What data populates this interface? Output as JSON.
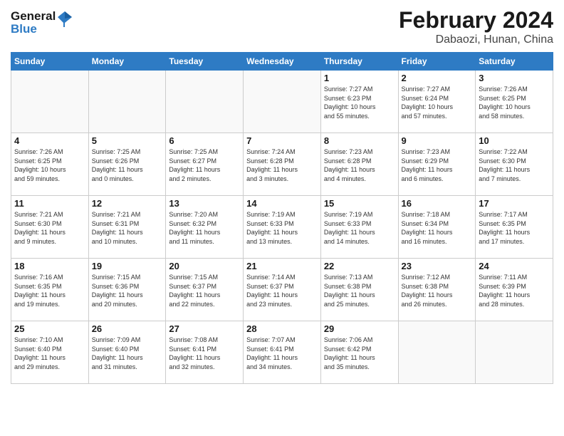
{
  "header": {
    "logo_line1": "General",
    "logo_line2": "Blue",
    "title": "February 2024",
    "subtitle": "Dabaozi, Hunan, China"
  },
  "weekdays": [
    "Sunday",
    "Monday",
    "Tuesday",
    "Wednesday",
    "Thursday",
    "Friday",
    "Saturday"
  ],
  "weeks": [
    [
      {
        "day": "",
        "info": ""
      },
      {
        "day": "",
        "info": ""
      },
      {
        "day": "",
        "info": ""
      },
      {
        "day": "",
        "info": ""
      },
      {
        "day": "1",
        "info": "Sunrise: 7:27 AM\nSunset: 6:23 PM\nDaylight: 10 hours\nand 55 minutes."
      },
      {
        "day": "2",
        "info": "Sunrise: 7:27 AM\nSunset: 6:24 PM\nDaylight: 10 hours\nand 57 minutes."
      },
      {
        "day": "3",
        "info": "Sunrise: 7:26 AM\nSunset: 6:25 PM\nDaylight: 10 hours\nand 58 minutes."
      }
    ],
    [
      {
        "day": "4",
        "info": "Sunrise: 7:26 AM\nSunset: 6:25 PM\nDaylight: 10 hours\nand 59 minutes."
      },
      {
        "day": "5",
        "info": "Sunrise: 7:25 AM\nSunset: 6:26 PM\nDaylight: 11 hours\nand 0 minutes."
      },
      {
        "day": "6",
        "info": "Sunrise: 7:25 AM\nSunset: 6:27 PM\nDaylight: 11 hours\nand 2 minutes."
      },
      {
        "day": "7",
        "info": "Sunrise: 7:24 AM\nSunset: 6:28 PM\nDaylight: 11 hours\nand 3 minutes."
      },
      {
        "day": "8",
        "info": "Sunrise: 7:23 AM\nSunset: 6:28 PM\nDaylight: 11 hours\nand 4 minutes."
      },
      {
        "day": "9",
        "info": "Sunrise: 7:23 AM\nSunset: 6:29 PM\nDaylight: 11 hours\nand 6 minutes."
      },
      {
        "day": "10",
        "info": "Sunrise: 7:22 AM\nSunset: 6:30 PM\nDaylight: 11 hours\nand 7 minutes."
      }
    ],
    [
      {
        "day": "11",
        "info": "Sunrise: 7:21 AM\nSunset: 6:30 PM\nDaylight: 11 hours\nand 9 minutes."
      },
      {
        "day": "12",
        "info": "Sunrise: 7:21 AM\nSunset: 6:31 PM\nDaylight: 11 hours\nand 10 minutes."
      },
      {
        "day": "13",
        "info": "Sunrise: 7:20 AM\nSunset: 6:32 PM\nDaylight: 11 hours\nand 11 minutes."
      },
      {
        "day": "14",
        "info": "Sunrise: 7:19 AM\nSunset: 6:33 PM\nDaylight: 11 hours\nand 13 minutes."
      },
      {
        "day": "15",
        "info": "Sunrise: 7:19 AM\nSunset: 6:33 PM\nDaylight: 11 hours\nand 14 minutes."
      },
      {
        "day": "16",
        "info": "Sunrise: 7:18 AM\nSunset: 6:34 PM\nDaylight: 11 hours\nand 16 minutes."
      },
      {
        "day": "17",
        "info": "Sunrise: 7:17 AM\nSunset: 6:35 PM\nDaylight: 11 hours\nand 17 minutes."
      }
    ],
    [
      {
        "day": "18",
        "info": "Sunrise: 7:16 AM\nSunset: 6:35 PM\nDaylight: 11 hours\nand 19 minutes."
      },
      {
        "day": "19",
        "info": "Sunrise: 7:15 AM\nSunset: 6:36 PM\nDaylight: 11 hours\nand 20 minutes."
      },
      {
        "day": "20",
        "info": "Sunrise: 7:15 AM\nSunset: 6:37 PM\nDaylight: 11 hours\nand 22 minutes."
      },
      {
        "day": "21",
        "info": "Sunrise: 7:14 AM\nSunset: 6:37 PM\nDaylight: 11 hours\nand 23 minutes."
      },
      {
        "day": "22",
        "info": "Sunrise: 7:13 AM\nSunset: 6:38 PM\nDaylight: 11 hours\nand 25 minutes."
      },
      {
        "day": "23",
        "info": "Sunrise: 7:12 AM\nSunset: 6:38 PM\nDaylight: 11 hours\nand 26 minutes."
      },
      {
        "day": "24",
        "info": "Sunrise: 7:11 AM\nSunset: 6:39 PM\nDaylight: 11 hours\nand 28 minutes."
      }
    ],
    [
      {
        "day": "25",
        "info": "Sunrise: 7:10 AM\nSunset: 6:40 PM\nDaylight: 11 hours\nand 29 minutes."
      },
      {
        "day": "26",
        "info": "Sunrise: 7:09 AM\nSunset: 6:40 PM\nDaylight: 11 hours\nand 31 minutes."
      },
      {
        "day": "27",
        "info": "Sunrise: 7:08 AM\nSunset: 6:41 PM\nDaylight: 11 hours\nand 32 minutes."
      },
      {
        "day": "28",
        "info": "Sunrise: 7:07 AM\nSunset: 6:41 PM\nDaylight: 11 hours\nand 34 minutes."
      },
      {
        "day": "29",
        "info": "Sunrise: 7:06 AM\nSunset: 6:42 PM\nDaylight: 11 hours\nand 35 minutes."
      },
      {
        "day": "",
        "info": ""
      },
      {
        "day": "",
        "info": ""
      }
    ]
  ]
}
